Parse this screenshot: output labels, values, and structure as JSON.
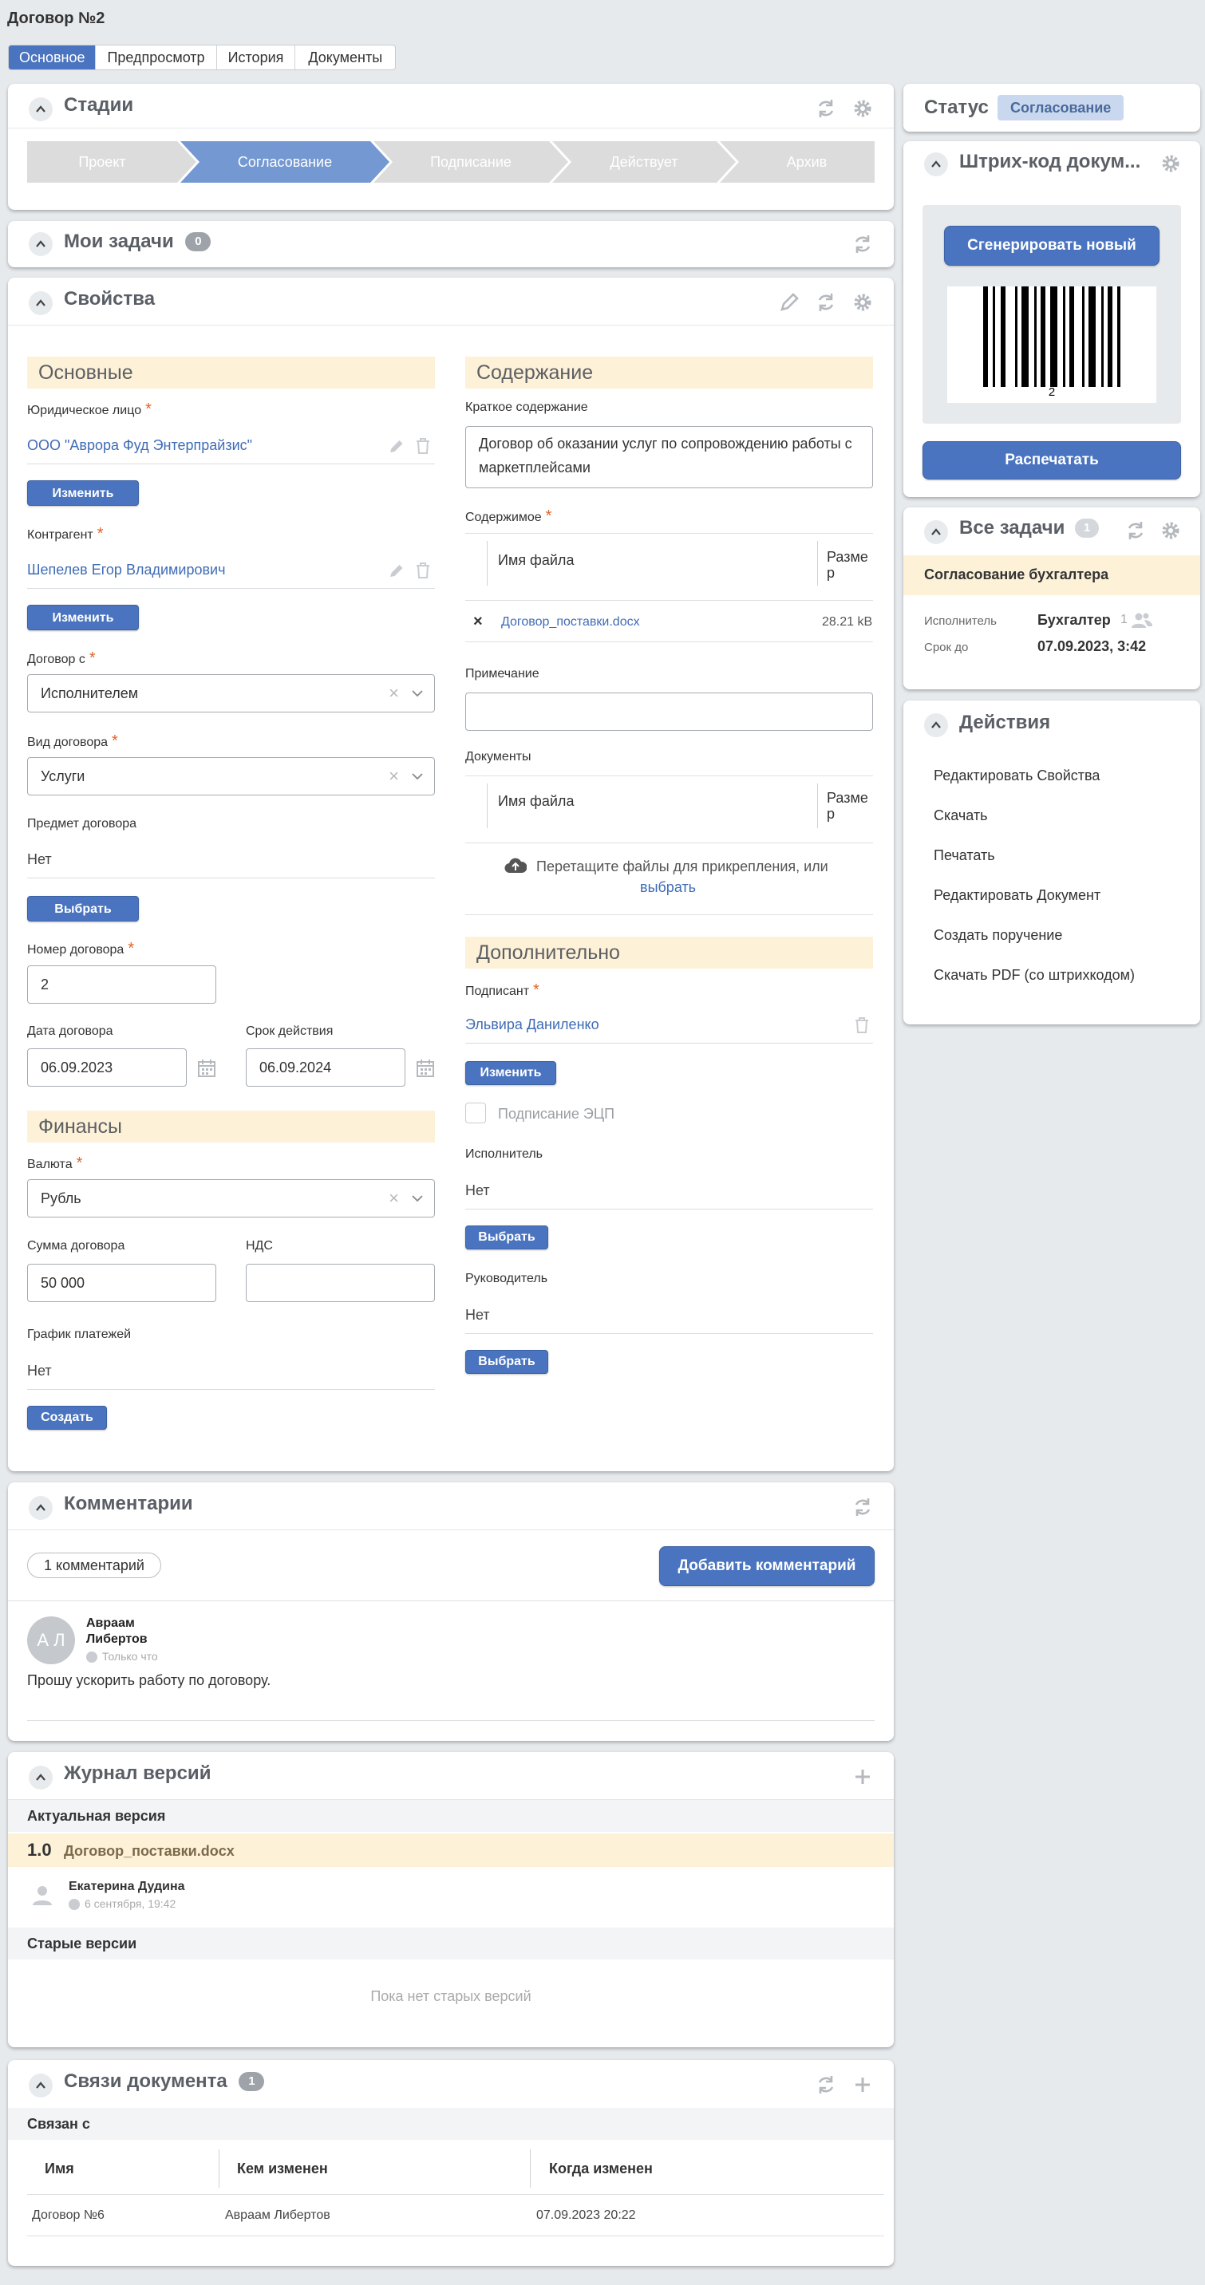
{
  "page_title": "Договор №2",
  "tabs": [
    "Основное",
    "Предпросмотр",
    "История",
    "Документы"
  ],
  "stages": {
    "title": "Стадии",
    "steps": [
      "Проект",
      "Согласование",
      "Подписание",
      "Действует",
      "Архив"
    ],
    "active_index": 1
  },
  "my_tasks": {
    "title": "Мои задачи",
    "count": "0"
  },
  "properties": {
    "title": "Свойства",
    "main": {
      "section_title": "Основные",
      "legal_entity_label": "Юридическое лицо",
      "legal_entity_value": "ООО \"Аврора Фуд Энтерпрайзис\"",
      "change_label": "Изменить",
      "counterparty_label": "Контрагент",
      "counterparty_value": "Шепелев Егор Владимирович",
      "contract_with_label": "Договор с",
      "contract_with_value": "Исполнителем",
      "contract_type_label": "Вид договора",
      "contract_type_value": "Услуги",
      "subject_label": "Предмет договора",
      "subject_value": "Нет",
      "select_label": "Выбрать",
      "number_label": "Номер договора",
      "number_value": "2",
      "date_label": "Дата договора",
      "date_value": "06.09.2023",
      "valid_label": "Срок действия",
      "valid_value": "06.09.2024"
    },
    "finance": {
      "section_title": "Финансы",
      "currency_label": "Валюта",
      "currency_value": "Рубль",
      "amount_label": "Сумма договора",
      "amount_value": "50 000",
      "vat_label": "НДС",
      "vat_value": "",
      "schedule_label": "График платежей",
      "schedule_value": "Нет",
      "create_label": "Создать"
    },
    "content": {
      "section_title": "Содержание",
      "summary_label": "Краткое содержание",
      "summary_value": "Договор об оказании услуг по сопровождению работы с маркетплейсами",
      "contents_label": "Содержимое",
      "col_filename": "Имя файла",
      "col_size": "Размер",
      "file_name": "Договор_поставки.docx",
      "file_size": "28.21 kB",
      "remove_glyph": "×",
      "note_label": "Примечание",
      "note_value": "",
      "docs_label": "Документы",
      "drop_text": "Перетащите файлы для прикрепления, или",
      "drop_link": "выбрать"
    },
    "additional": {
      "section_title": "Дополнительно",
      "signer_label": "Подписант",
      "signer_value": "Эльвира Даниленко",
      "change_label": "Изменить",
      "eds_label": "Подписание ЭЦП",
      "executor_label": "Исполнитель",
      "executor_value": "Нет",
      "select_label": "Выбрать",
      "manager_label": "Руководитель",
      "manager_value": "Нет"
    }
  },
  "comments": {
    "title": "Комментарии",
    "count_label": "1 комментарий",
    "add_label": "Добавить комментарий",
    "items": [
      {
        "initials": "А Л",
        "author_first": "Авраам",
        "author_last": "Либертов",
        "time": "Только что",
        "text": "Прошу ускорить работу по договору."
      }
    ]
  },
  "versions": {
    "title": "Журнал версий",
    "current_label": "Актуальная версия",
    "version_num": "1.0",
    "version_file": "Договор_поставки.docx",
    "version_author": "Екатерина Дудина",
    "version_time": "6 сентября, 19:42",
    "old_label": "Старые версии",
    "empty_text": "Пока нет старых версий"
  },
  "links": {
    "title": "Связи документа",
    "count": "1",
    "related_label": "Связан с",
    "col_name": "Имя",
    "col_changed_by": "Кем изменен",
    "col_changed_at": "Когда изменен",
    "rows": [
      {
        "name": "Договор №6",
        "changed_by": "Авраам Либертов",
        "changed_at": "07.09.2023 20:22"
      }
    ]
  },
  "status": {
    "label": "Статус",
    "value": "Согласование"
  },
  "barcode": {
    "title": "Штрих-код докум...",
    "generate_label": "Сгенерировать новый",
    "code_text": "2",
    "print_label": "Распечатать"
  },
  "all_tasks": {
    "title": "Все задачи",
    "count": "1",
    "task_title": "Согласование бухгалтера",
    "executor_label": "Исполнитель",
    "executor_value": "Бухгалтер",
    "executor_count": "1",
    "due_label": "Срок до",
    "due_value": "07.09.2023, 3:42"
  },
  "actions": {
    "title": "Действия",
    "items": [
      "Редактировать Свойства",
      "Скачать",
      "Печатать",
      "Редактировать Документ",
      "Создать поручение",
      "Скачать PDF (со штрихкодом)"
    ]
  },
  "colors": {
    "accent": "#4a74bf",
    "stage_active": "#7498d2",
    "section_bg": "#fdf1d8",
    "page_bg": "#e7eaed"
  }
}
